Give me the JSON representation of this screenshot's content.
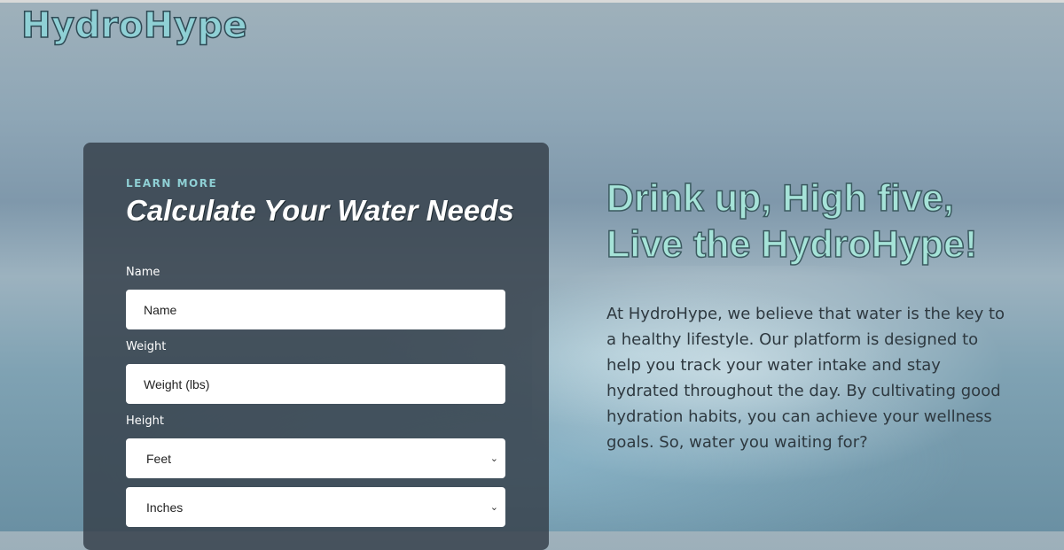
{
  "brand": {
    "logo_text": "HydroHype"
  },
  "calculator": {
    "eyebrow": "LEARN MORE",
    "title": "Calculate Your Water Needs",
    "fields": {
      "name": {
        "label": "Name",
        "placeholder": "Name"
      },
      "weight": {
        "label": "Weight",
        "placeholder": "Weight (lbs)"
      },
      "height": {
        "label": "Height",
        "feet": {
          "selected": "Feet"
        },
        "inches": {
          "selected": "Inches"
        }
      }
    }
  },
  "hero": {
    "headline_line1": "Drink up, High five,",
    "headline_line2": "Live the HydroHype!",
    "description": "At HydroHype, we believe that water is the key to a healthy lifestyle. Our platform is designed to help you track your water intake and stay hydrated throughout the day. By cultivating good hydration habits, you can achieve your wellness goals. So, water you waiting for?"
  },
  "icons": {
    "select_arrow": "chevron-down-icon"
  },
  "colors": {
    "accent": "#8fd0d5",
    "card": "#37424c",
    "headline": "#a6e3d8"
  }
}
